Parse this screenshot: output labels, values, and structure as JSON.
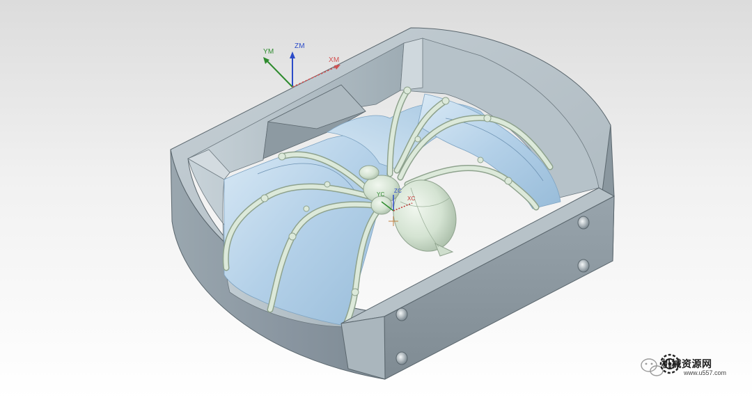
{
  "wcs_axes": {
    "y": "YM",
    "z": "ZM",
    "x": "XM"
  },
  "work_axes": {
    "y": "YC",
    "z": "ZC",
    "x": "XC"
  },
  "watermark": {
    "name": "机械资源网",
    "url": "www.u557.com"
  },
  "icons": [
    "wcs-triad-icon",
    "csys-marker-icon",
    "wechat-icon",
    "gear-logo-icon"
  ],
  "colors": {
    "background_top": "#dcdcdc",
    "background_bottom": "#ffffff",
    "mold_gray": "#a7b4bb",
    "cavity_blue": "#bcd8ee",
    "spider_green": "#d4e3d2",
    "axis_x": "#d25050",
    "axis_y": "#2e8b2e",
    "axis_z": "#2b4bc8"
  }
}
